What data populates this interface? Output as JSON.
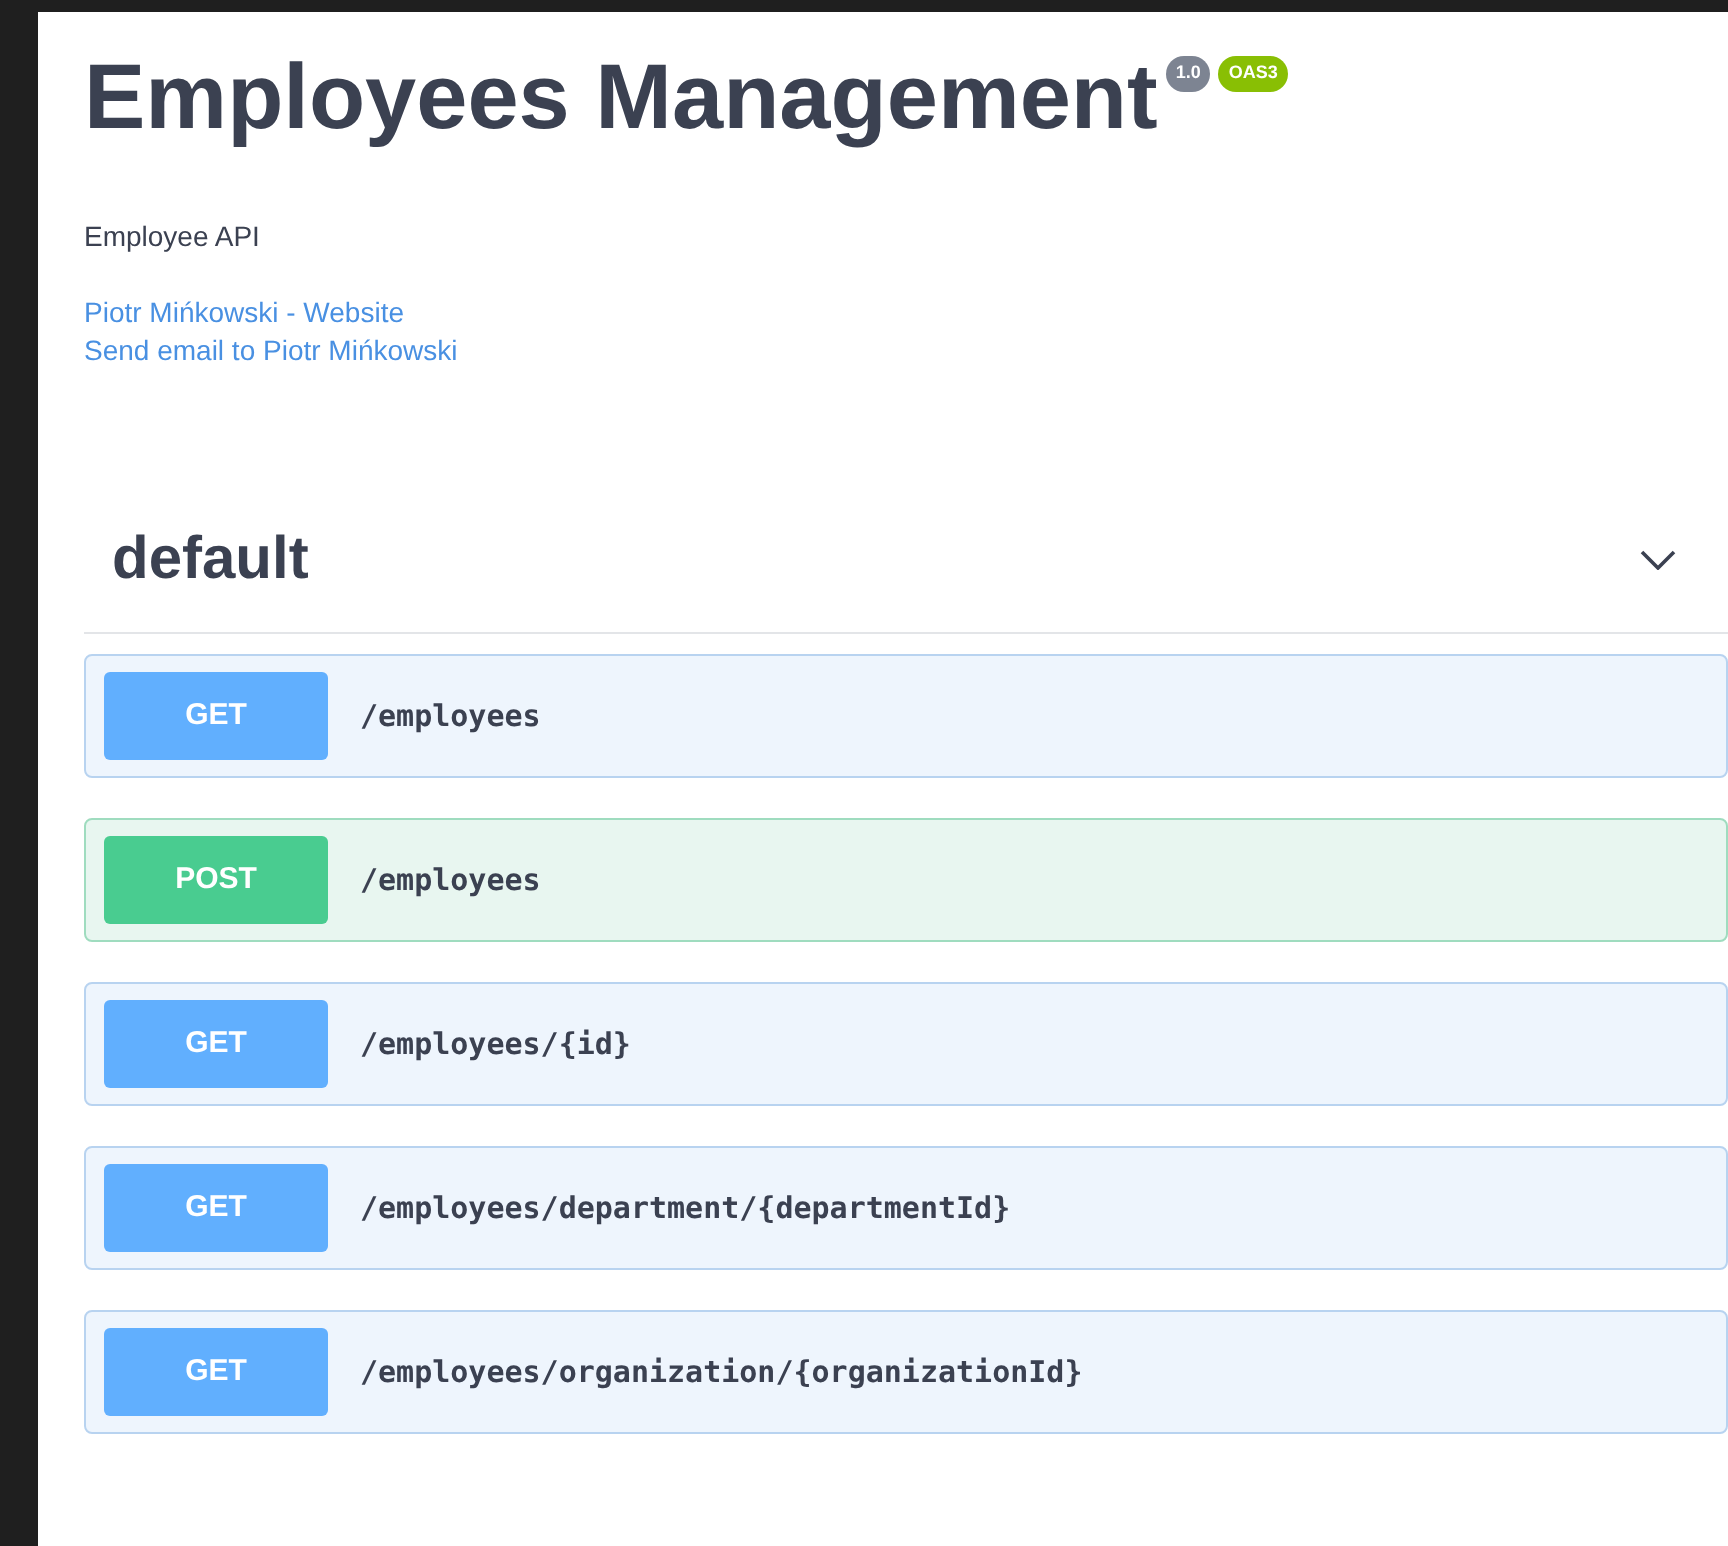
{
  "info": {
    "title": "Employees Management",
    "version": "1.0",
    "spec": "OAS3",
    "description": "Employee API",
    "links": [
      "Piotr Mińkowski - Website",
      "Send email to Piotr Mińkowski"
    ]
  },
  "section": {
    "name": "default",
    "operations": [
      {
        "method": "GET",
        "kind": "get",
        "path": "/employees"
      },
      {
        "method": "POST",
        "kind": "post",
        "path": "/employees"
      },
      {
        "method": "GET",
        "kind": "get",
        "path": "/employees/{id}"
      },
      {
        "method": "GET",
        "kind": "get",
        "path": "/employees/department/{departmentId}"
      },
      {
        "method": "GET",
        "kind": "get",
        "path": "/employees/organization/{organizationId}"
      }
    ]
  }
}
